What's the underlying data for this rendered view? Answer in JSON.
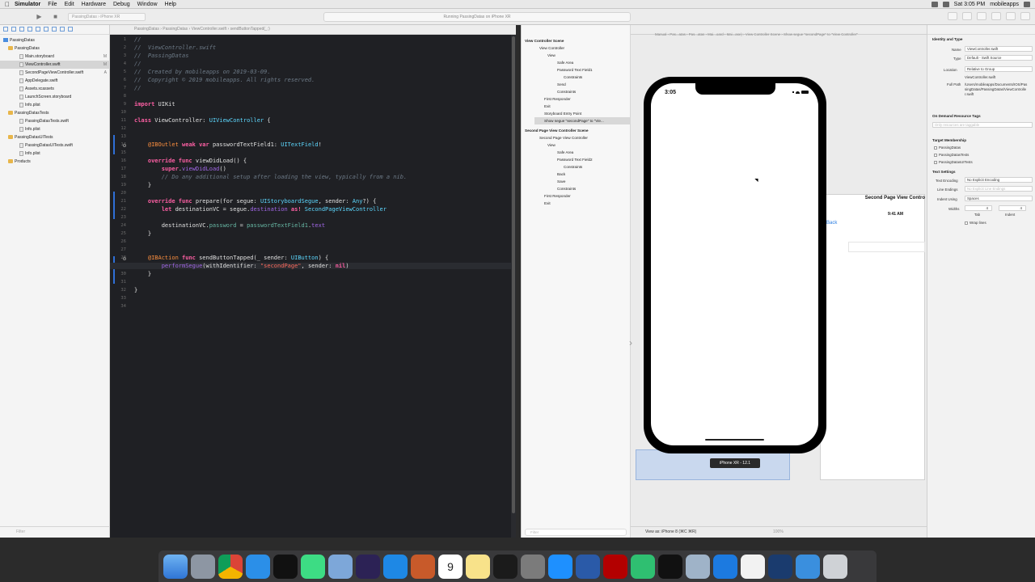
{
  "menubar": {
    "app_name": "Simulator",
    "items": [
      "File",
      "Edit",
      "Hardware",
      "Debug",
      "Window",
      "Help"
    ],
    "clock": "Sat 3:05 PM",
    "user": "mobileapps"
  },
  "toolbar": {
    "scheme": "PassingDatas  ›  iPhone XR",
    "activity": "Running PassingDatas on iPhone XR"
  },
  "navigator": {
    "items": [
      {
        "label": "PassingDatas",
        "kind": "project",
        "badge": ""
      },
      {
        "label": "PassingDatas",
        "kind": "folder",
        "badge": ""
      },
      {
        "label": "Main.storyboard",
        "kind": "file",
        "badge": "M"
      },
      {
        "label": "ViewController.swift",
        "kind": "file",
        "badge": "M"
      },
      {
        "label": "SecondPageViewController.swift",
        "kind": "file",
        "badge": "A"
      },
      {
        "label": "AppDelegate.swift",
        "kind": "file",
        "badge": ""
      },
      {
        "label": "Assets.xcassets",
        "kind": "file",
        "badge": ""
      },
      {
        "label": "LaunchScreen.storyboard",
        "kind": "file",
        "badge": ""
      },
      {
        "label": "Info.plist",
        "kind": "file",
        "badge": ""
      },
      {
        "label": "PassingDatasTests",
        "kind": "folder",
        "badge": ""
      },
      {
        "label": "PassingDatasTests.swift",
        "kind": "file",
        "badge": ""
      },
      {
        "label": "Info.plist",
        "kind": "file",
        "badge": ""
      },
      {
        "label": "PassingDatasUITests",
        "kind": "folder",
        "badge": ""
      },
      {
        "label": "PassingDatasUITests.swift",
        "kind": "file",
        "badge": ""
      },
      {
        "label": "Info.plist",
        "kind": "file",
        "badge": ""
      },
      {
        "label": "Products",
        "kind": "folder",
        "badge": ""
      }
    ],
    "filter_placeholder": "Filter"
  },
  "editor": {
    "jumpbar": "PassingDatas  ›  PassingDatas  ›  ViewController.swift  ›  sendButtonTapped(_:)",
    "current_line": 29
  },
  "outline": {
    "items": [
      {
        "label": "View Controller Scene",
        "bold": true
      },
      {
        "label": "View Controller",
        "bold": false
      },
      {
        "label": "View",
        "bold": false
      },
      {
        "label": "Safe Area",
        "bold": false
      },
      {
        "label": "Password Text Field1",
        "bold": false
      },
      {
        "label": "Constraints",
        "bold": false
      },
      {
        "label": "Send",
        "bold": false
      },
      {
        "label": "Constraints",
        "bold": false
      },
      {
        "label": "First Responder",
        "bold": false
      },
      {
        "label": "Exit",
        "bold": false
      },
      {
        "label": "Storyboard Entry Point",
        "bold": false
      },
      {
        "label": "Show segue \"secondPage\" to \"Vie...",
        "bold": false
      },
      {
        "label": "Second Page View Controller Scene",
        "bold": true
      },
      {
        "label": "Second Page View Controller",
        "bold": false
      },
      {
        "label": "View",
        "bold": false
      },
      {
        "label": "Safe Area",
        "bold": false
      },
      {
        "label": "Password Text Field2",
        "bold": false
      },
      {
        "label": "Constraints",
        "bold": false
      },
      {
        "label": "Back",
        "bold": false
      },
      {
        "label": "Save",
        "bold": false
      },
      {
        "label": "Constraints",
        "bold": false
      },
      {
        "label": "First Responder",
        "bold": false
      },
      {
        "label": "Exit",
        "bold": false
      }
    ],
    "filter_placeholder": "Filter"
  },
  "canvas": {
    "jumpbar": "Manual  ›  Pas...atas  ›  Pas...atas  ›  Mai...oard  ›  Mai...ase)  ›  View Controller Scene  ›  Show segue \"secondPage\" to \"View Controller\"",
    "phone_time": "3:05",
    "device_label": "iPhone XR - 12.1",
    "second_scene_title": "Second Page View Contro",
    "second_scene_time": "9:41 AM",
    "back_label": "Back",
    "view_as": "View as: iPhone 8 (⌘C ⌘R)",
    "zoom": "100%"
  },
  "inspector": {
    "identity_header": "Identity and Type",
    "name_label": "Name",
    "name_value": "ViewController.swift",
    "type_label": "Type",
    "type_value": "Default - Swift Source",
    "location_label": "Location",
    "location_value": "Relative to Group",
    "location_file": "ViewController.swift",
    "fullpath_label": "Full Path",
    "fullpath_value": "/Users/mobileapps/Documents/IOS/PassingDatas/PassingDatas/ViewController.swift",
    "ondemand_header": "On Demand Resource Tags",
    "ondemand_placeholder": "Only resources are taggable",
    "target_header": "Target Membership",
    "targets": [
      "PassingDatas",
      "PassingDatasTests",
      "PassingDatasUITests"
    ],
    "text_header": "Text Settings",
    "encoding_label": "Text Encoding",
    "encoding_value": "No Explicit Encoding",
    "line_label": "Line Endings",
    "line_value": "No Explicit Line Endings",
    "indent_label": "Indent Using",
    "indent_value": "Spaces",
    "widths_label": "Widths",
    "tab_value": "4",
    "indent_value2": "4",
    "tab_label": "Tab",
    "indent_label2": "Indent",
    "wrap_label": "Wrap lines"
  },
  "dock": {
    "apps": [
      "finder-icon",
      "launchpad-icon",
      "chrome-icon",
      "safari-icon",
      "intellij-icon",
      "android-studio-icon",
      "virtualbox-icon",
      "eclipse-icon",
      "maps-icon",
      "books-icon",
      "calendar-icon",
      "notes-icon",
      "activity-monitor-icon",
      "system-preferences-icon",
      "transmit-icon",
      "sourcetree-icon",
      "filezilla-icon",
      "atom-icon",
      "terminal-icon",
      "settings-icon",
      "xcode-icon",
      "textedit-icon",
      "quicktime-icon",
      "folder-icon",
      "trash-icon"
    ],
    "calendar_day": "9"
  }
}
